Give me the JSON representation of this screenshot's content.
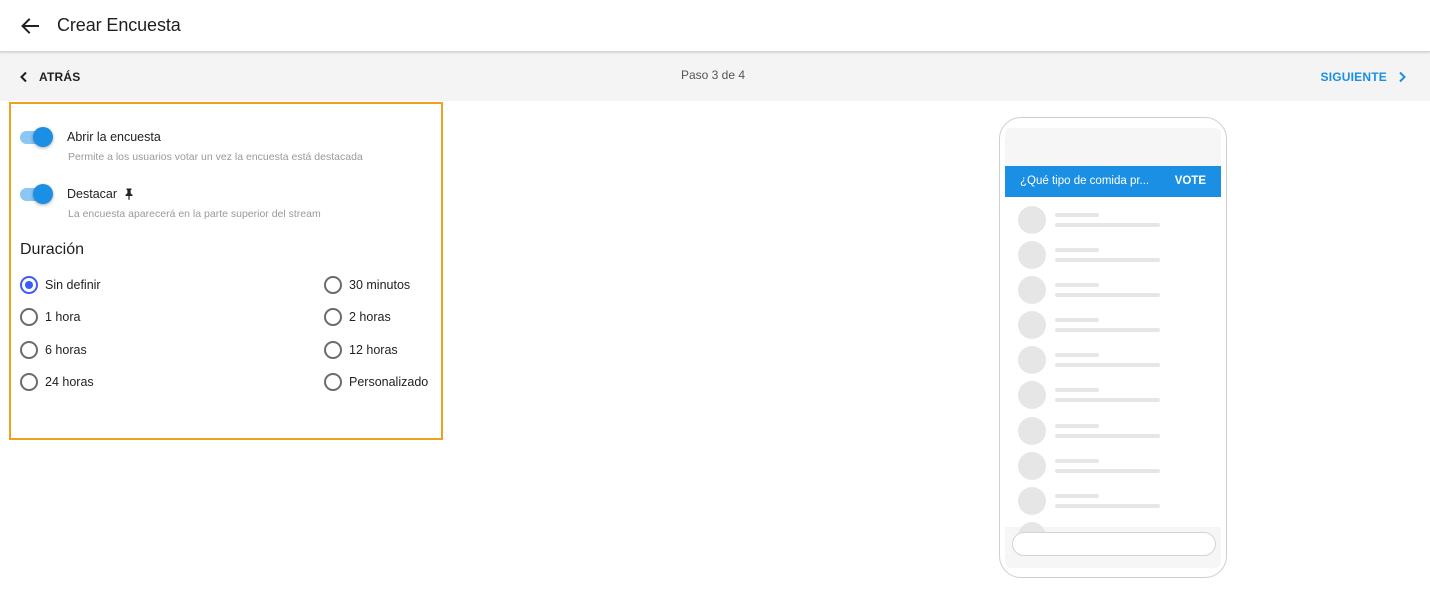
{
  "header": {
    "back_icon": "arrow-left-icon",
    "title": "Crear Encuesta"
  },
  "stepbar": {
    "back_label": "ATRÁS",
    "step_text": "Paso 3 de 4",
    "next_label": "SIGUIENTE"
  },
  "settings": {
    "open_poll": {
      "label": "Abrir la encuesta",
      "description": "Permite a los usuarios votar un vez la encuesta está destacada",
      "enabled": true
    },
    "feature": {
      "label": "Destacar",
      "icon": "pin-icon",
      "description": "La encuesta aparecerá en la parte superior del stream",
      "enabled": true
    },
    "duration": {
      "title": "Duración",
      "selected": "Sin definir",
      "options": [
        "Sin definir",
        "30 minutos",
        "1 hora",
        "2 horas",
        "6 horas",
        "12 horas",
        "24 horas",
        "Personalizado"
      ]
    }
  },
  "preview": {
    "question": "¿Qué tipo de comida pr...",
    "vote_label": "VOTE"
  },
  "colors": {
    "accent": "#1a8fe3",
    "radio_selected": "#3d5afe",
    "highlight_border": "#f0a020"
  }
}
